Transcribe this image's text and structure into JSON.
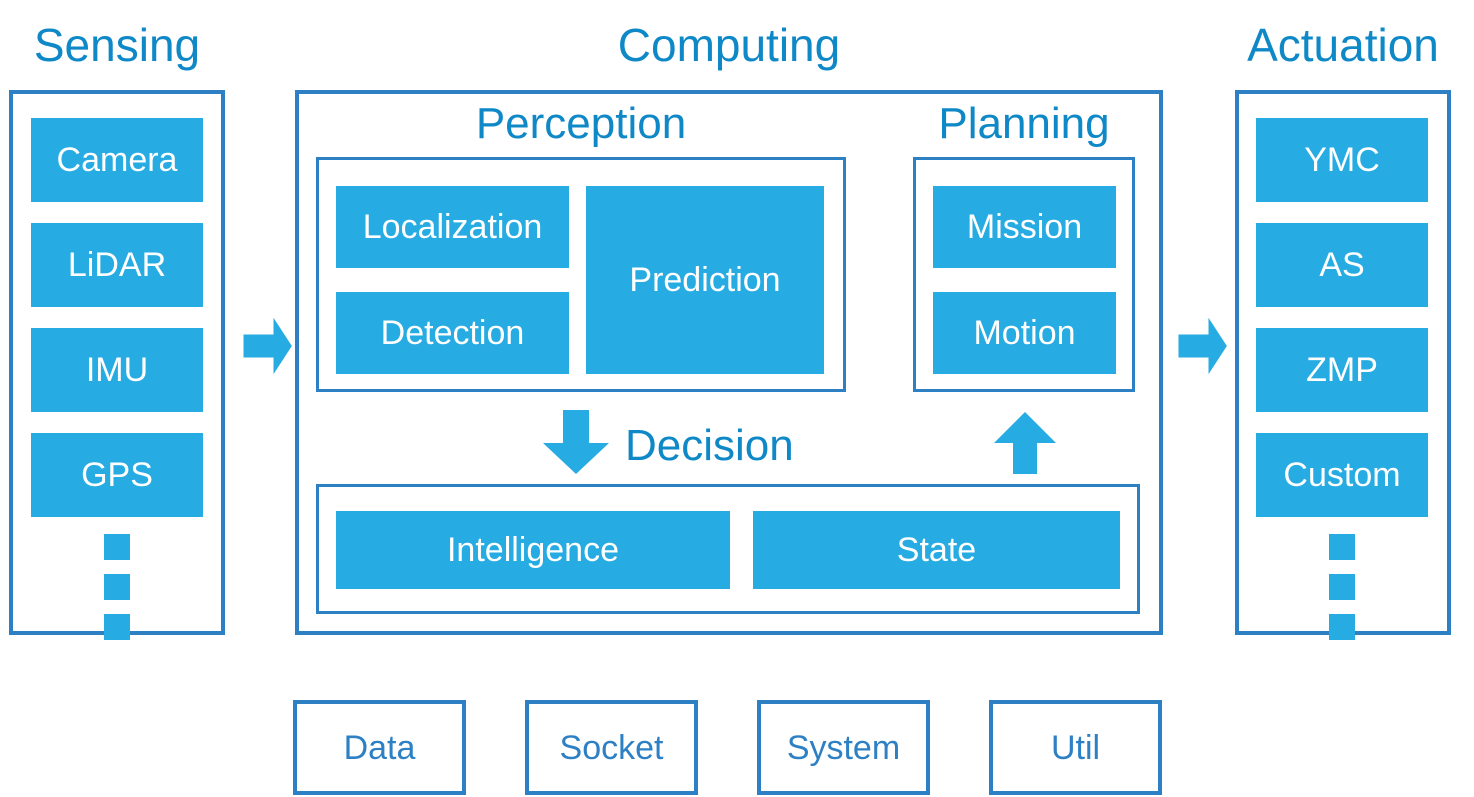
{
  "diagram": {
    "title_color": "#0E88C6",
    "chip_color": "#26ABE2",
    "border_color": "#2E80C4",
    "arrow_color": "#26ABE2"
  },
  "sensing": {
    "title": "Sensing",
    "items": [
      {
        "label": "Camera"
      },
      {
        "label": "LiDAR"
      },
      {
        "label": "IMU"
      },
      {
        "label": "GPS"
      }
    ],
    "ellipsis": "vertical-ellipsis"
  },
  "computing": {
    "title": "Computing",
    "perception": {
      "title": "Perception",
      "items": [
        {
          "label": "Localization"
        },
        {
          "label": "Detection"
        },
        {
          "label": "Prediction"
        }
      ]
    },
    "planning": {
      "title": "Planning",
      "items": [
        {
          "label": "Mission"
        },
        {
          "label": "Motion"
        }
      ]
    },
    "decision": {
      "title": "Decision",
      "items": [
        {
          "label": "Intelligence"
        },
        {
          "label": "State"
        }
      ]
    }
  },
  "actuation": {
    "title": "Actuation",
    "items": [
      {
        "label": "YMC"
      },
      {
        "label": "AS"
      },
      {
        "label": "ZMP"
      },
      {
        "label": "Custom"
      }
    ],
    "ellipsis": "vertical-ellipsis"
  },
  "support": {
    "items": [
      {
        "label": "Data"
      },
      {
        "label": "Socket"
      },
      {
        "label": "System"
      },
      {
        "label": "Util"
      }
    ]
  },
  "arrows": {
    "sensing_to_computing": "arrow-right-icon",
    "computing_to_actuation": "arrow-right-icon",
    "perception_to_decision": "arrow-down-icon",
    "decision_to_planning": "arrow-up-icon"
  }
}
